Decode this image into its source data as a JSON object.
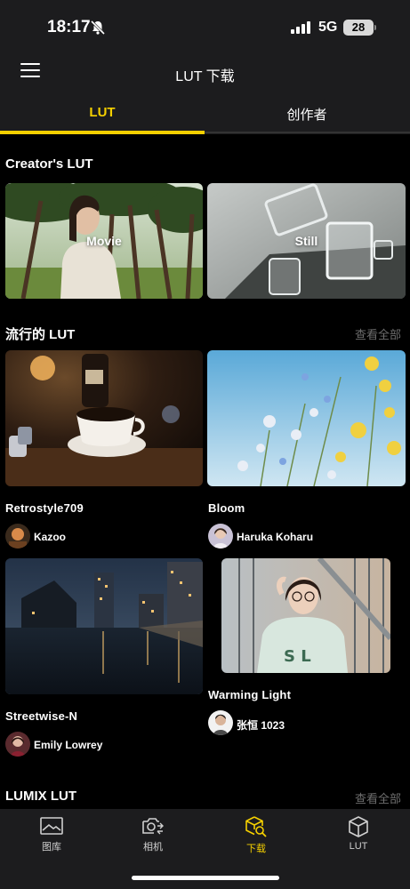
{
  "status_bar": {
    "time": "18:17",
    "network": "5G",
    "battery": "28"
  },
  "header": {
    "title": "LUT 下载"
  },
  "tabs": [
    {
      "label": "LUT",
      "active": true
    },
    {
      "label": "创作者",
      "active": false
    }
  ],
  "creators_section": {
    "title": "Creator's LUT",
    "cards": [
      {
        "label": "Movie"
      },
      {
        "label": "Still"
      }
    ]
  },
  "popular_section": {
    "title": "流行的 LUT",
    "see_all": "查看全部",
    "items": [
      {
        "name": "Retrostyle709",
        "author": "Kazoo"
      },
      {
        "name": "Bloom",
        "author": "Haruka Koharu"
      },
      {
        "name": "Streetwise-N",
        "author": "Emily Lowrey"
      },
      {
        "name": "Warming Light",
        "author": "张恒 1023"
      }
    ]
  },
  "lumix_section": {
    "title": "LUMIX LUT",
    "see_all": "查看全部"
  },
  "bottom_nav": [
    {
      "label": "图库",
      "icon": "gallery-icon",
      "active": false
    },
    {
      "label": "相机",
      "icon": "camera-icon",
      "active": false
    },
    {
      "label": "下载",
      "icon": "download-icon",
      "active": true
    },
    {
      "label": "LUT",
      "icon": "lut-cube-icon",
      "active": false
    }
  ],
  "colors": {
    "accent": "#f5d000",
    "bar_bg": "#1c1c1e",
    "page_bg": "#000000",
    "muted_text": "#6e6e6e"
  }
}
